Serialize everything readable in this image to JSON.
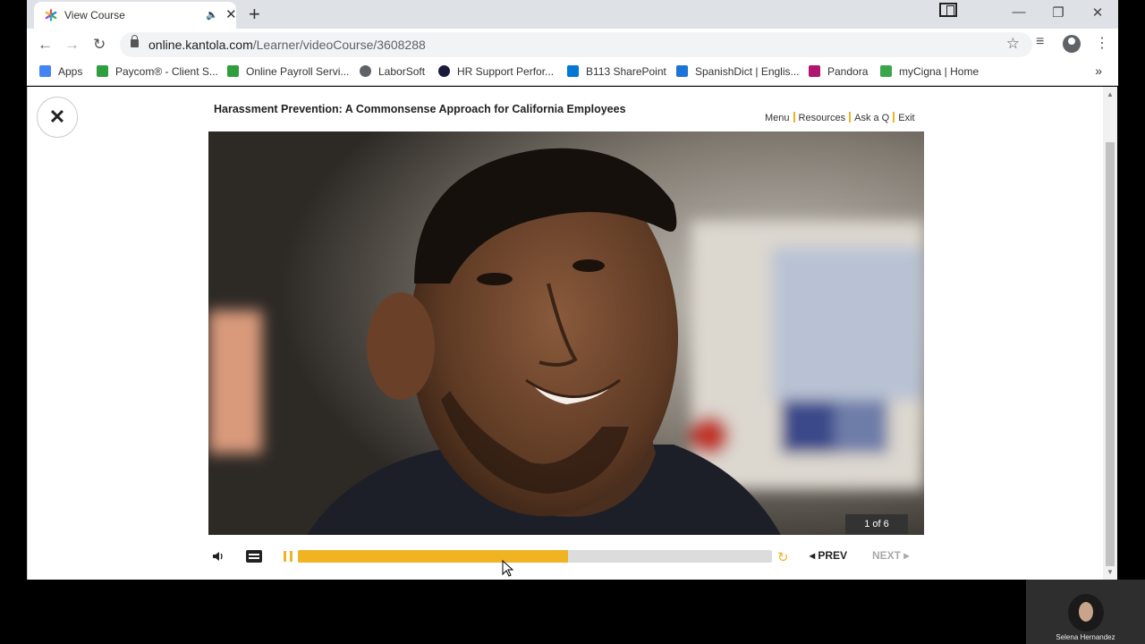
{
  "browser": {
    "tab_title": "View Course",
    "url_host": "online.kantola.com",
    "url_path": "/Learner/videoCourse/3608288",
    "bookmarks": [
      {
        "label": "Apps",
        "icon": "apps-grid-icon",
        "color": "#4285f4"
      },
      {
        "label": "Paycom® - Client S...",
        "icon": "paycom-icon",
        "color": "#2e9e3e"
      },
      {
        "label": "Online Payroll Servi...",
        "icon": "paycom-icon",
        "color": "#2e9e3e"
      },
      {
        "label": "LaborSoft",
        "icon": "globe-icon",
        "color": "#5f6368"
      },
      {
        "label": "HR Support Perfor...",
        "icon": "hr-support-icon",
        "color": "#1a1a3a"
      },
      {
        "label": "B113 SharePoint",
        "icon": "sharepoint-icon",
        "color": "#0078d4"
      },
      {
        "label": "SpanishDict | Englis...",
        "icon": "spanishdict-icon",
        "color": "#1d74d6"
      },
      {
        "label": "Pandora",
        "icon": "pandora-icon",
        "color": "#b0166d"
      },
      {
        "label": "myCigna | Home",
        "icon": "cigna-icon",
        "color": "#3aa64c"
      }
    ]
  },
  "course": {
    "title": "Harassment Prevention: A Commonsense Approach for California Employees",
    "menu_items": [
      "Menu",
      "Resources",
      "Ask a Q",
      "Exit"
    ],
    "slide_counter": "1 of 6",
    "prev_label": "PREV",
    "next_label": "NEXT",
    "progress_fraction": 0.57,
    "accent_color": "#f0b323"
  },
  "webcam": {
    "name": "Selena Hernandez"
  }
}
